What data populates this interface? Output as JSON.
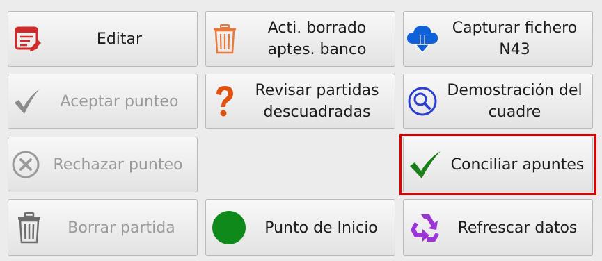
{
  "buttons": {
    "editar": {
      "label": "Editar",
      "icon": "edit-form-icon",
      "enabled": true
    },
    "acti_borrado": {
      "label": "Acti. borrado\naptes. banco",
      "icon": "trash-can-icon",
      "enabled": true
    },
    "capturar_fichero": {
      "label": "Capturar fichero\nN43",
      "icon": "cloud-download-icon",
      "enabled": true
    },
    "aceptar_punteo": {
      "label": "Aceptar punteo",
      "icon": "checkmark-icon",
      "enabled": false
    },
    "revisar_partidas": {
      "label": "Revisar partidas\ndescuadradas",
      "icon": "question-mark-icon",
      "enabled": true
    },
    "demostracion_cuadre": {
      "label": "Demostración del\ncuadre",
      "icon": "magnifier-icon",
      "enabled": true
    },
    "rechazar_punteo": {
      "label": "Rechazar punteo",
      "icon": "circle-x-icon",
      "enabled": false
    },
    "conciliar_apuntes": {
      "label": "Conciliar apuntes",
      "icon": "green-check-icon",
      "enabled": true,
      "selected": true
    },
    "borrar_partida": {
      "label": "Borrar partida",
      "icon": "trash-icon",
      "enabled": false
    },
    "punto_inicio": {
      "label": "Punto de Inicio",
      "icon": "green-circle-icon",
      "enabled": true
    },
    "refrescar_datos": {
      "label": "Refrescar datos",
      "icon": "recycle-icon",
      "enabled": true
    }
  },
  "colors": {
    "background": "#ececec",
    "selection_border": "#e00000",
    "disabled_text": "#9a9a9a",
    "accent_green": "#1a7f1a",
    "cloud_blue": "#1060d8",
    "recycle_purple": "#9b35d8",
    "question_orange": "#e05010"
  }
}
